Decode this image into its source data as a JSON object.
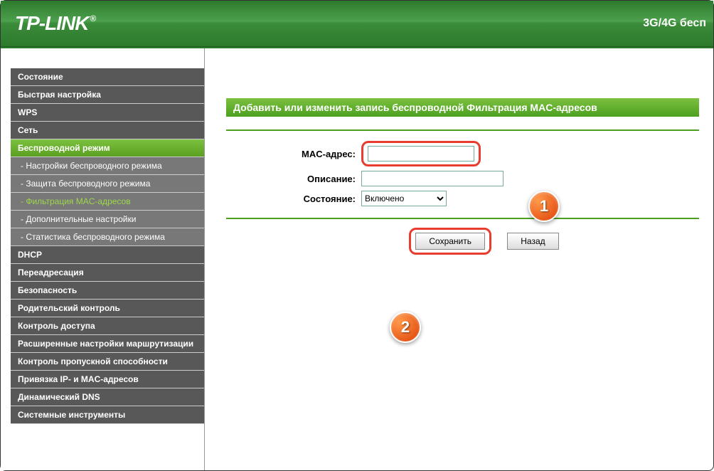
{
  "header": {
    "logo": "TP-LINK",
    "tagline": "3G/4G бесп"
  },
  "menu": {
    "items": [
      {
        "label": "Состояние",
        "type": "top"
      },
      {
        "label": "Быстрая настройка",
        "type": "top"
      },
      {
        "label": "WPS",
        "type": "top"
      },
      {
        "label": "Сеть",
        "type": "top"
      },
      {
        "label": "Беспроводной режим",
        "type": "active-top"
      },
      {
        "label": "- Настройки беспроводного режима",
        "type": "sub"
      },
      {
        "label": "- Защита беспроводного режима",
        "type": "sub"
      },
      {
        "label": "- Фильтрация MAC-адресов",
        "type": "sub-active"
      },
      {
        "label": "- Дополнительные настройки",
        "type": "sub"
      },
      {
        "label": "- Статистика беспроводного режима",
        "type": "sub"
      },
      {
        "label": "DHCP",
        "type": "top"
      },
      {
        "label": "Переадресация",
        "type": "top"
      },
      {
        "label": "Безопасность",
        "type": "top"
      },
      {
        "label": "Родительский контроль",
        "type": "top"
      },
      {
        "label": "Контроль доступа",
        "type": "top"
      },
      {
        "label": "Расширенные настройки маршрутизации",
        "type": "top"
      },
      {
        "label": "Контроль пропускной способности",
        "type": "top"
      },
      {
        "label": "Привязка IP- и MAC-адресов",
        "type": "top"
      },
      {
        "label": "Динамический DNS",
        "type": "top"
      },
      {
        "label": "Системные инструменты",
        "type": "top"
      }
    ]
  },
  "page": {
    "title": "Добавить или изменить запись беспроводной Фильтрация MAC-адресов"
  },
  "form": {
    "mac_label": "MAC-адрес:",
    "mac_value": "",
    "desc_label": "Описание:",
    "desc_value": "",
    "state_label": "Состояние:",
    "state_value": "Включено",
    "save_label": "Сохранить",
    "back_label": "Назад"
  },
  "callouts": {
    "c1": "1",
    "c2": "2"
  }
}
